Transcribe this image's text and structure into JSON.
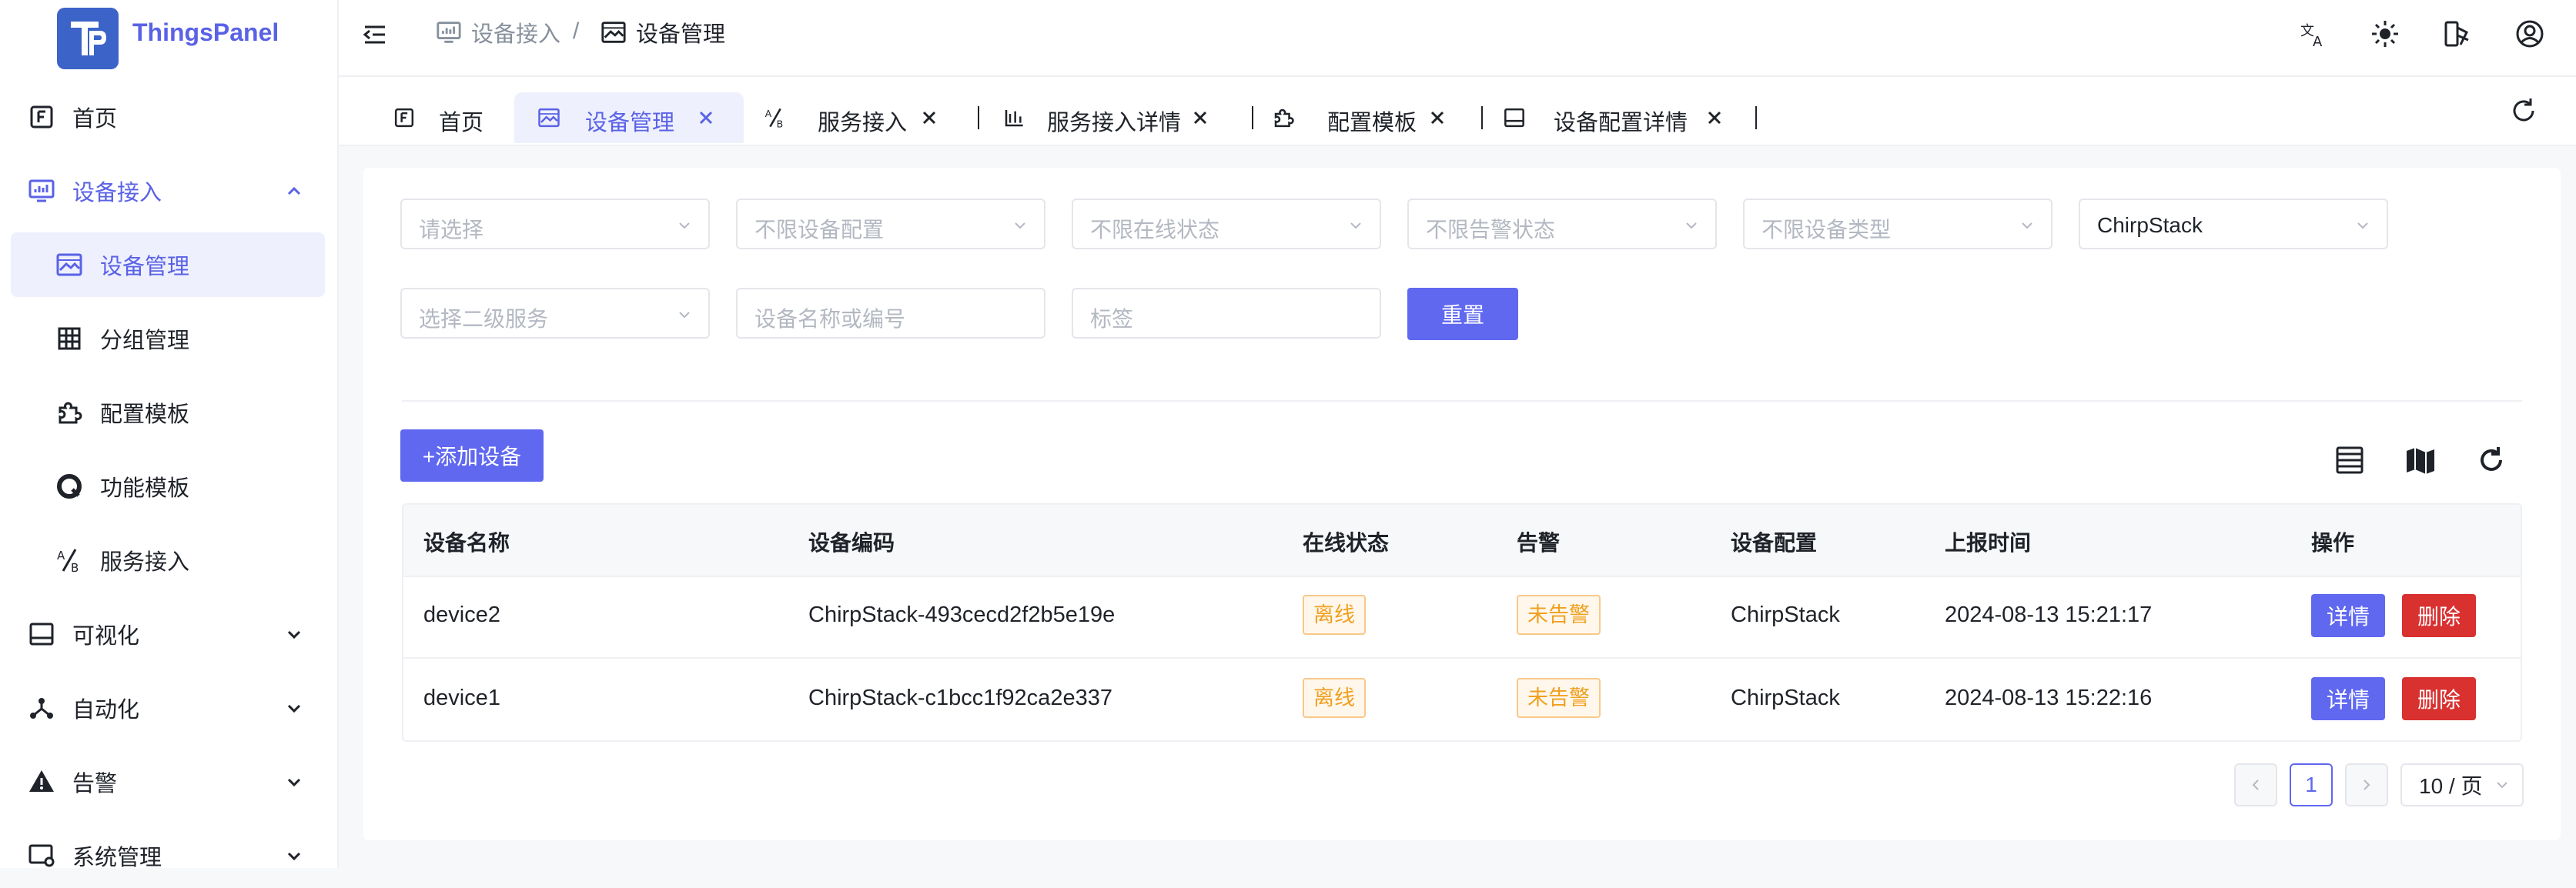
{
  "app": {
    "brand": "ThingsPanel"
  },
  "sidebar": {
    "items": [
      {
        "label": "首页",
        "icon": "home-f-icon"
      },
      {
        "label": "设备接入",
        "icon": "monitor-chart-icon",
        "state": "expanded"
      },
      {
        "label": "设备管理",
        "icon": "picture-icon",
        "state": "selected"
      },
      {
        "label": "分组管理",
        "icon": "grid-icon"
      },
      {
        "label": "配置模板",
        "icon": "puzzle-icon"
      },
      {
        "label": "功能模板",
        "icon": "q-circle-icon"
      },
      {
        "label": "服务接入",
        "icon": "ratio-icon"
      },
      {
        "label": "可视化",
        "icon": "screen-icon"
      },
      {
        "label": "自动化",
        "icon": "network-icon"
      },
      {
        "label": "告警",
        "icon": "warning-icon"
      },
      {
        "label": "系统管理",
        "icon": "settings-screen-icon"
      }
    ]
  },
  "header": {
    "breadcrumb": [
      "设备接入",
      "设备管理"
    ],
    "separator": "/",
    "icons": [
      "translate-icon",
      "sun-icon",
      "theme-icon",
      "user-icon"
    ]
  },
  "tabs": [
    {
      "label": "首页",
      "closable": false
    },
    {
      "label": "设备管理",
      "active": true
    },
    {
      "label": "服务接入"
    },
    {
      "label": "服务接入详情"
    },
    {
      "label": "配置模板"
    },
    {
      "label": "设备配置详情"
    }
  ],
  "filters": {
    "select_placeholder": "请选择",
    "device_config": "不限设备配置",
    "online_status": "不限在线状态",
    "alarm_status": "不限告警状态",
    "device_type": "不限设备类型",
    "service": "ChirpStack",
    "secondary_service": "选择二级服务",
    "name_or_code": "设备名称或编号",
    "tag": "标签",
    "reset_label": "重置"
  },
  "toolbar": {
    "add_label": "+添加设备"
  },
  "table": {
    "columns": [
      "设备名称",
      "设备编码",
      "在线状态",
      "告警",
      "设备配置",
      "上报时间",
      "操作"
    ],
    "rows": [
      {
        "name": "device2",
        "code": "ChirpStack-493cecd2f2b5e19e",
        "online": "离线",
        "alarm": "未告警",
        "config": "ChirpStack",
        "time": "2024-08-13 15:21:17",
        "detail": "详情",
        "delete": "删除"
      },
      {
        "name": "device1",
        "code": "ChirpStack-c1bcc1f92ca2e337",
        "online": "离线",
        "alarm": "未告警",
        "config": "ChirpStack",
        "time": "2024-08-13 15:22:16",
        "detail": "详情",
        "delete": "删除"
      }
    ]
  },
  "pagination": {
    "current_page": "1",
    "page_size": "10 / 页"
  },
  "colors": {
    "accent": "#6068f0",
    "danger": "#d93030",
    "warning": "#f0a020",
    "brand_logo": "#3b63c8"
  }
}
